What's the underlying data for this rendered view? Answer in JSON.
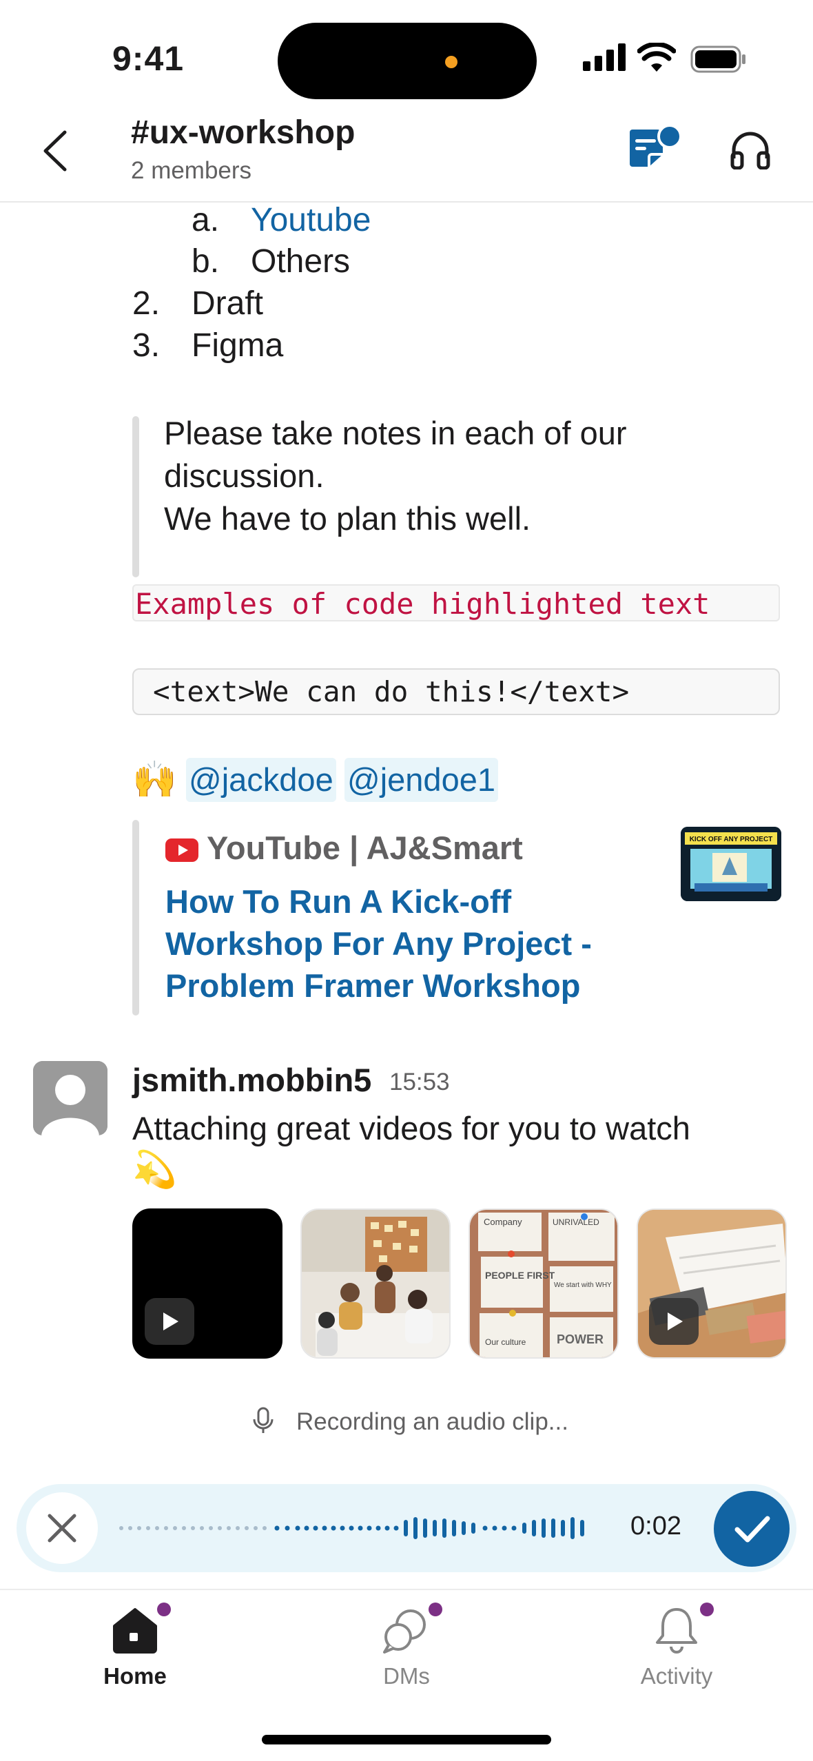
{
  "status_bar": {
    "time": "9:41"
  },
  "header": {
    "channel_name": "#ux-workshop",
    "members": "2 members"
  },
  "content": {
    "sub_list": [
      {
        "marker": "a.",
        "text": "Youtube",
        "is_link": true
      },
      {
        "marker": "b.",
        "text": "Others",
        "is_link": false
      }
    ],
    "main_list": [
      {
        "marker": "2.",
        "text": "Draft"
      },
      {
        "marker": "3.",
        "text": "Figma"
      }
    ],
    "quote_lines": [
      "Please take notes in each of our",
      "discussion.",
      "We have to plan this well."
    ],
    "inline_code": "Examples of code highlighted text",
    "code_block": "<text>We can do this!</text>",
    "emoji": "🙌",
    "mentions": [
      "@jackdoe",
      "@jendoe1"
    ],
    "link_preview": {
      "source": "YouTube | AJ&Smart",
      "title_lines": [
        "How To Run A Kick-off",
        "Workshop For Any Project -",
        "Problem Framer Workshop"
      ],
      "thumbnail_caption": "KICK OFF ANY PROJECT"
    }
  },
  "message": {
    "author": "jsmith.mobbin5",
    "time": "15:53",
    "text": "Attaching great videos for you to watch",
    "emoji": "💫",
    "attachments": [
      {
        "kind": "video",
        "desc": "black video"
      },
      {
        "kind": "image",
        "desc": "meeting photo"
      },
      {
        "kind": "image",
        "desc": "sticky notes board"
      },
      {
        "kind": "video",
        "desc": "desk with papers"
      }
    ],
    "sticky_notes": [
      "Company",
      "UNRIVALED",
      "PEOPLE FIRST",
      "We start with WHY",
      "Our culture",
      "POWER"
    ]
  },
  "recording": {
    "label": "Recording an audio clip...",
    "elapsed": "0:02"
  },
  "tabs": [
    {
      "label": "Home",
      "active": true,
      "icon": "home-icon"
    },
    {
      "label": "DMs",
      "active": false,
      "icon": "dms-icon"
    },
    {
      "label": "Activity",
      "active": false,
      "icon": "bell-icon"
    }
  ],
  "colors": {
    "link": "#1264a3",
    "code": "#c01343",
    "accent_dot": "#7c3085",
    "recorder_bg": "#e8f5fa"
  }
}
